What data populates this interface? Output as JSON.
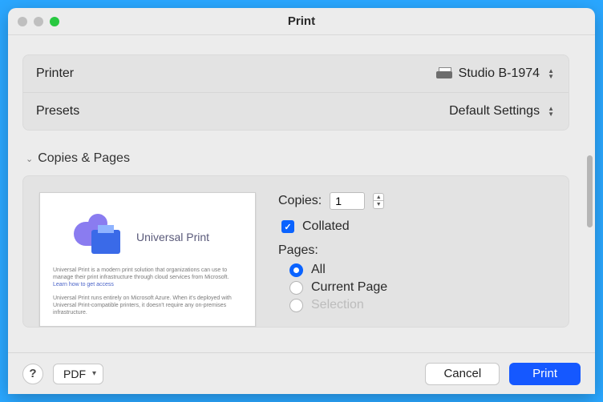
{
  "window": {
    "title": "Print"
  },
  "printer": {
    "label": "Printer",
    "selected": "Studio B-1974"
  },
  "presets": {
    "label": "Presets",
    "selected": "Default Settings"
  },
  "section_title": "Copies & Pages",
  "copies": {
    "label": "Copies:",
    "value": "1",
    "collated_label": "Collated",
    "collated_checked": true
  },
  "pages": {
    "label": "Pages:",
    "options": {
      "all": "All",
      "current": "Current Page",
      "selection": "Selection"
    },
    "selected": "all"
  },
  "preview": {
    "title": "Universal Print",
    "p1a": "Universal Print is a modern print solution that organizations can use to manage their print infrastructure through cloud services from Microsoft. ",
    "p1link": "Learn how to get access",
    "p2": "Universal Print runs entirely on Microsoft Azure. When it's deployed with Universal Print-compatible printers, it doesn't require any on-premises infrastructure."
  },
  "footer": {
    "help": "?",
    "pdf": "PDF",
    "cancel": "Cancel",
    "print": "Print"
  }
}
